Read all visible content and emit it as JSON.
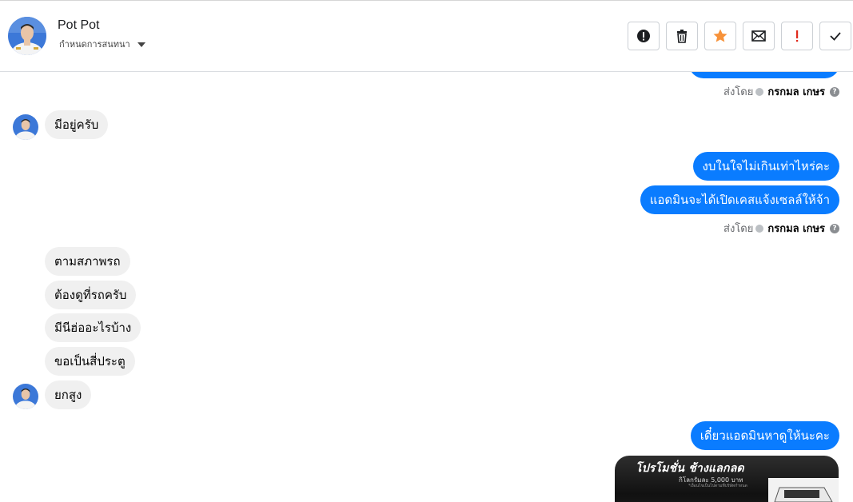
{
  "header": {
    "name": "Pot Pot",
    "status_label": "กำหนดการสนทนา"
  },
  "actions": [
    {
      "icon": "alert-circle-icon"
    },
    {
      "icon": "trash-icon"
    },
    {
      "icon": "star-icon",
      "color": "#f7923a"
    },
    {
      "icon": "mail-icon"
    },
    {
      "icon": "exclamation-icon",
      "color": "#e02a1c"
    },
    {
      "icon": "check-icon"
    }
  ],
  "messages": {
    "in_1": "มีอยู่ครับ",
    "out_1": "งบในใจไม่เกินเท่าไหร่คะ",
    "out_2": "แอดมินจะได้เปิดเคสแจ้งเซลล์ให้จ้า",
    "in_2": "ตามสภาพรถ",
    "in_3": "ต้องดูที่รถครับ",
    "in_4": "มีนีฮ่ออะไรบ้าง",
    "in_5": "ขอเป็นสี่ประตู",
    "in_6": "ยกสูง",
    "out_3": "เดี๋ยวแอดมินหาดูให้นะคะ"
  },
  "sent_by": {
    "prefix": "ส่งโดย",
    "agent": "กรกมล เกษร"
  },
  "promo": {
    "title": "โปรโมชั่น ช้างแลกลด",
    "subtitle": "กิโลกรัมละ 5,000 บาท",
    "fineprint": "*เงื่อนไขเป็นไปตามที่บริษัทกำหนด"
  },
  "colors": {
    "outgoing_bubble": "#0a7cff",
    "incoming_bubble": "#f0f0f0"
  }
}
